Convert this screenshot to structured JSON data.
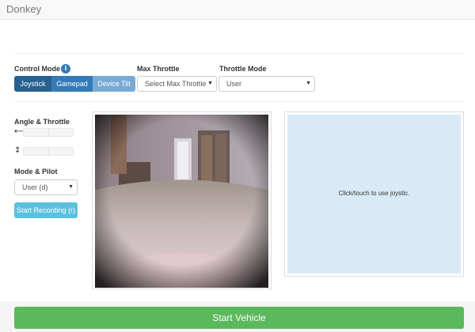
{
  "app": {
    "brand": "Donkey"
  },
  "control_mode": {
    "label": "Control Mode",
    "info_icon": "info-icon",
    "buttons": [
      "Joystick",
      "Gamepad",
      "Device Tilt"
    ],
    "active": "Joystick"
  },
  "max_throttle": {
    "label": "Max Throttle",
    "value": "Select Max Throttle"
  },
  "throttle_mode": {
    "label": "Throttle Mode",
    "value": "User"
  },
  "angle_throttle": {
    "label": "Angle & Throttle",
    "angle_icon": "horizontal-arrow-icon",
    "throttle_icon": "vertical-arrow-icon"
  },
  "mode_pilot": {
    "label": "Mode & Pilot",
    "value": "User (d)"
  },
  "recording": {
    "label": "Start Recording (r)"
  },
  "joystick": {
    "prompt": "Click/touch to use joystic."
  },
  "footer": {
    "start_label": "Start Vehicle"
  },
  "colors": {
    "primary_dark": "#286090",
    "primary": "#337ab7",
    "primary_light": "#79aad6",
    "info": "#5bc0de",
    "success": "#5cb85c",
    "joystick_bg": "#d9eaf7"
  }
}
